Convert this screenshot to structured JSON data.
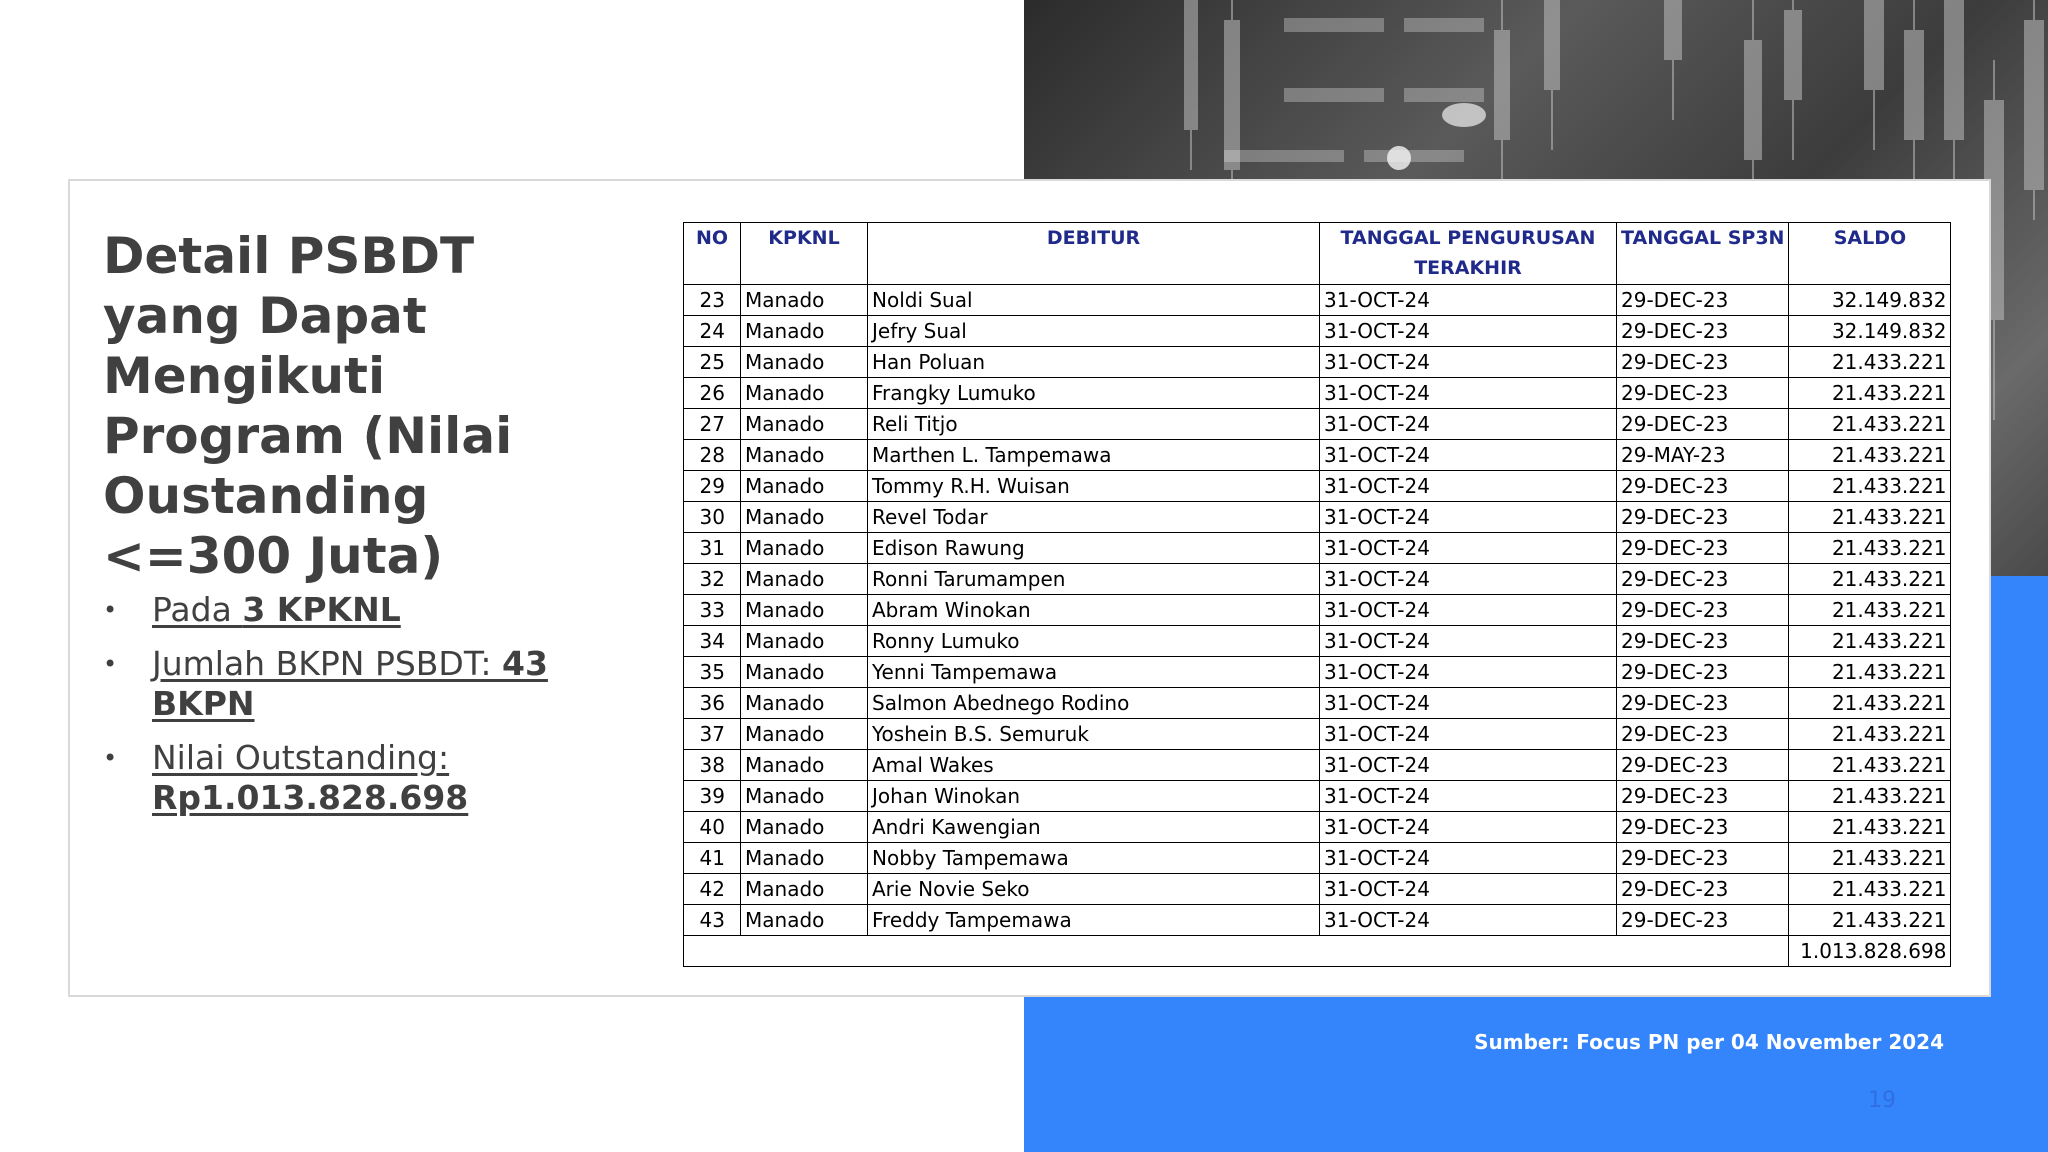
{
  "slide": {
    "title": "Detail PSBDT yang Dapat Mengikuti Program (Nilai Oustanding <=300 Juta)",
    "bullets": [
      {
        "prefix": "Pada ",
        "bold": "3 KPKNL"
      },
      {
        "prefix": "Jumlah BKPN PSBDT: ",
        "bold": "43 BKPN"
      },
      {
        "prefix": "Nilai Outstanding: ",
        "bold": "Rp1.013.828.698"
      }
    ],
    "bullet_char": "•",
    "source": "Sumber: Focus PN per 04 November 2024",
    "page_number": "19",
    "colors": {
      "accent_blue": "#3484fc",
      "title_gray": "#404040",
      "header_navy": "#1f2a8a"
    }
  },
  "table": {
    "headers": [
      "NO",
      "KPKNL",
      "DEBITUR",
      "TANGGAL PENGURUSAN TERAKHIR",
      "TANGGAL SP3N",
      "SALDO"
    ],
    "rows": [
      [
        "23",
        "Manado",
        "Noldi Sual",
        "31-OCT-24",
        "29-DEC-23",
        "32.149.832"
      ],
      [
        "24",
        "Manado",
        "Jefry Sual",
        "31-OCT-24",
        "29-DEC-23",
        "32.149.832"
      ],
      [
        "25",
        "Manado",
        "Han Poluan",
        "31-OCT-24",
        "29-DEC-23",
        "21.433.221"
      ],
      [
        "26",
        "Manado",
        "Frangky Lumuko",
        "31-OCT-24",
        "29-DEC-23",
        "21.433.221"
      ],
      [
        "27",
        "Manado",
        "Reli Titjo",
        "31-OCT-24",
        "29-DEC-23",
        "21.433.221"
      ],
      [
        "28",
        "Manado",
        "Marthen L. Tampemawa",
        "31-OCT-24",
        "29-MAY-23",
        "21.433.221"
      ],
      [
        "29",
        "Manado",
        "Tommy R.H. Wuisan",
        "31-OCT-24",
        "29-DEC-23",
        "21.433.221"
      ],
      [
        "30",
        "Manado",
        "Revel Todar",
        "31-OCT-24",
        "29-DEC-23",
        "21.433.221"
      ],
      [
        "31",
        "Manado",
        "Edison Rawung",
        "31-OCT-24",
        "29-DEC-23",
        "21.433.221"
      ],
      [
        "32",
        "Manado",
        "Ronni Tarumampen",
        "31-OCT-24",
        "29-DEC-23",
        "21.433.221"
      ],
      [
        "33",
        "Manado",
        "Abram Winokan",
        "31-OCT-24",
        "29-DEC-23",
        "21.433.221"
      ],
      [
        "34",
        "Manado",
        "Ronny Lumuko",
        "31-OCT-24",
        "29-DEC-23",
        "21.433.221"
      ],
      [
        "35",
        "Manado",
        "Yenni Tampemawa",
        "31-OCT-24",
        "29-DEC-23",
        "21.433.221"
      ],
      [
        "36",
        "Manado",
        "Salmon Abednego Rodino",
        "31-OCT-24",
        "29-DEC-23",
        "21.433.221"
      ],
      [
        "37",
        "Manado",
        "Yoshein B.S. Semuruk",
        "31-OCT-24",
        "29-DEC-23",
        "21.433.221"
      ],
      [
        "38",
        "Manado",
        "Amal Wakes",
        "31-OCT-24",
        "29-DEC-23",
        "21.433.221"
      ],
      [
        "39",
        "Manado",
        "Johan Winokan",
        "31-OCT-24",
        "29-DEC-23",
        "21.433.221"
      ],
      [
        "40",
        "Manado",
        "Andri Kawengian",
        "31-OCT-24",
        "29-DEC-23",
        "21.433.221"
      ],
      [
        "41",
        "Manado",
        "Nobby Tampemawa",
        "31-OCT-24",
        "29-DEC-23",
        "21.433.221"
      ],
      [
        "42",
        "Manado",
        "Arie Novie Seko",
        "31-OCT-24",
        "29-DEC-23",
        "21.433.221"
      ],
      [
        "43",
        "Manado",
        "Freddy Tampemawa",
        "31-OCT-24",
        "29-DEC-23",
        "21.433.221"
      ]
    ],
    "total": "1.013.828.698"
  }
}
